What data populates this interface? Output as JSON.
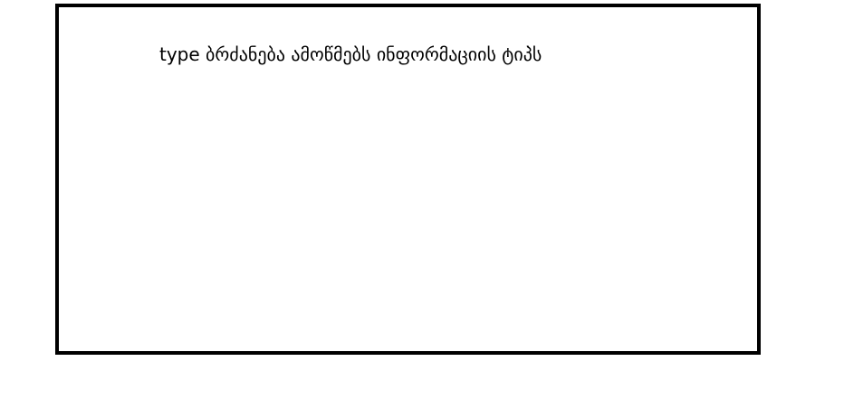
{
  "frame": {
    "caption": "type ბრძანება ამოწმებს ინფორმაციის ტიპს",
    "border_color": "#000000",
    "background_color": "#ffffff"
  }
}
